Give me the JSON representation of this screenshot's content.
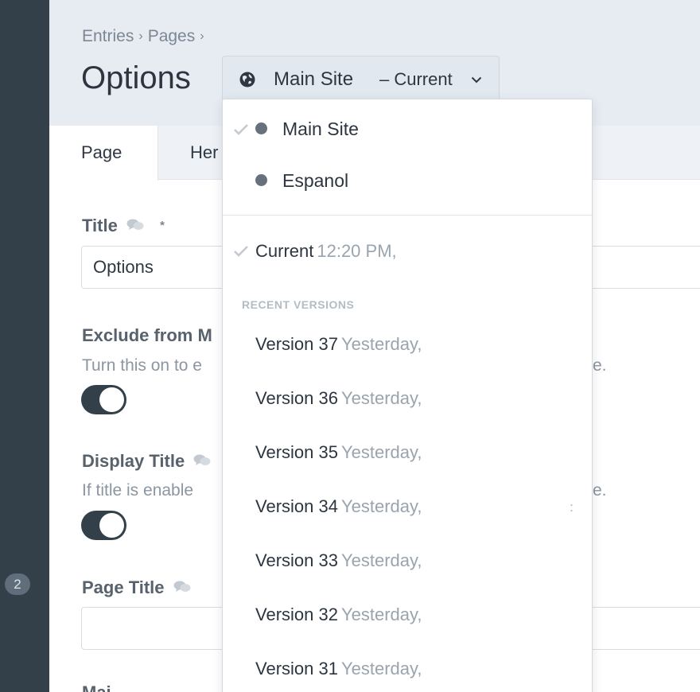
{
  "sidebar": {
    "badge_count": "2"
  },
  "breadcrumb": {
    "items": [
      "Entries",
      "Pages"
    ],
    "separator": "›"
  },
  "page": {
    "title": "Options"
  },
  "site_switcher": {
    "site_name": "Main Site",
    "version_label": "– Current",
    "icon": "globe-icon"
  },
  "tabs": [
    {
      "label": "Page",
      "active": true
    },
    {
      "label": "Her",
      "active": false
    }
  ],
  "fields": {
    "title": {
      "label": "Title",
      "required": "*",
      "value": "Options"
    },
    "exclude": {
      "label": "Exclude from M",
      "description": "Turn this on to e",
      "description_tail": "e.",
      "enabled": true
    },
    "display_title": {
      "label": "Display Title",
      "description": "If title is enable",
      "description_tail": "e.",
      "enabled": true
    },
    "page_title": {
      "label": "Page Title",
      "value": ""
    },
    "next_label": "Mai"
  },
  "dropdown": {
    "sites": [
      {
        "name": "Main Site",
        "selected": true
      },
      {
        "name": "Espanol",
        "selected": false
      }
    ],
    "current": {
      "label": "Current",
      "time": "12:20 PM,"
    },
    "recent_heading": "RECENT VERSIONS",
    "versions": [
      {
        "label": "Version 37",
        "time": "Yesterday,"
      },
      {
        "label": "Version 36",
        "time": "Yesterday,"
      },
      {
        "label": "Version 35",
        "time": "Yesterday,"
      },
      {
        "label": "Version 34",
        "time": "Yesterday,"
      },
      {
        "label": "Version 33",
        "time": "Yesterday,"
      },
      {
        "label": "Version 32",
        "time": "Yesterday,"
      },
      {
        "label": "Version 31",
        "time": "Yesterday,"
      }
    ]
  },
  "colors": {
    "sidebar": "#33404a",
    "header_bg": "#e7ecf3",
    "toggle_on": "#33404a",
    "muted_text": "#9aa4ae"
  }
}
